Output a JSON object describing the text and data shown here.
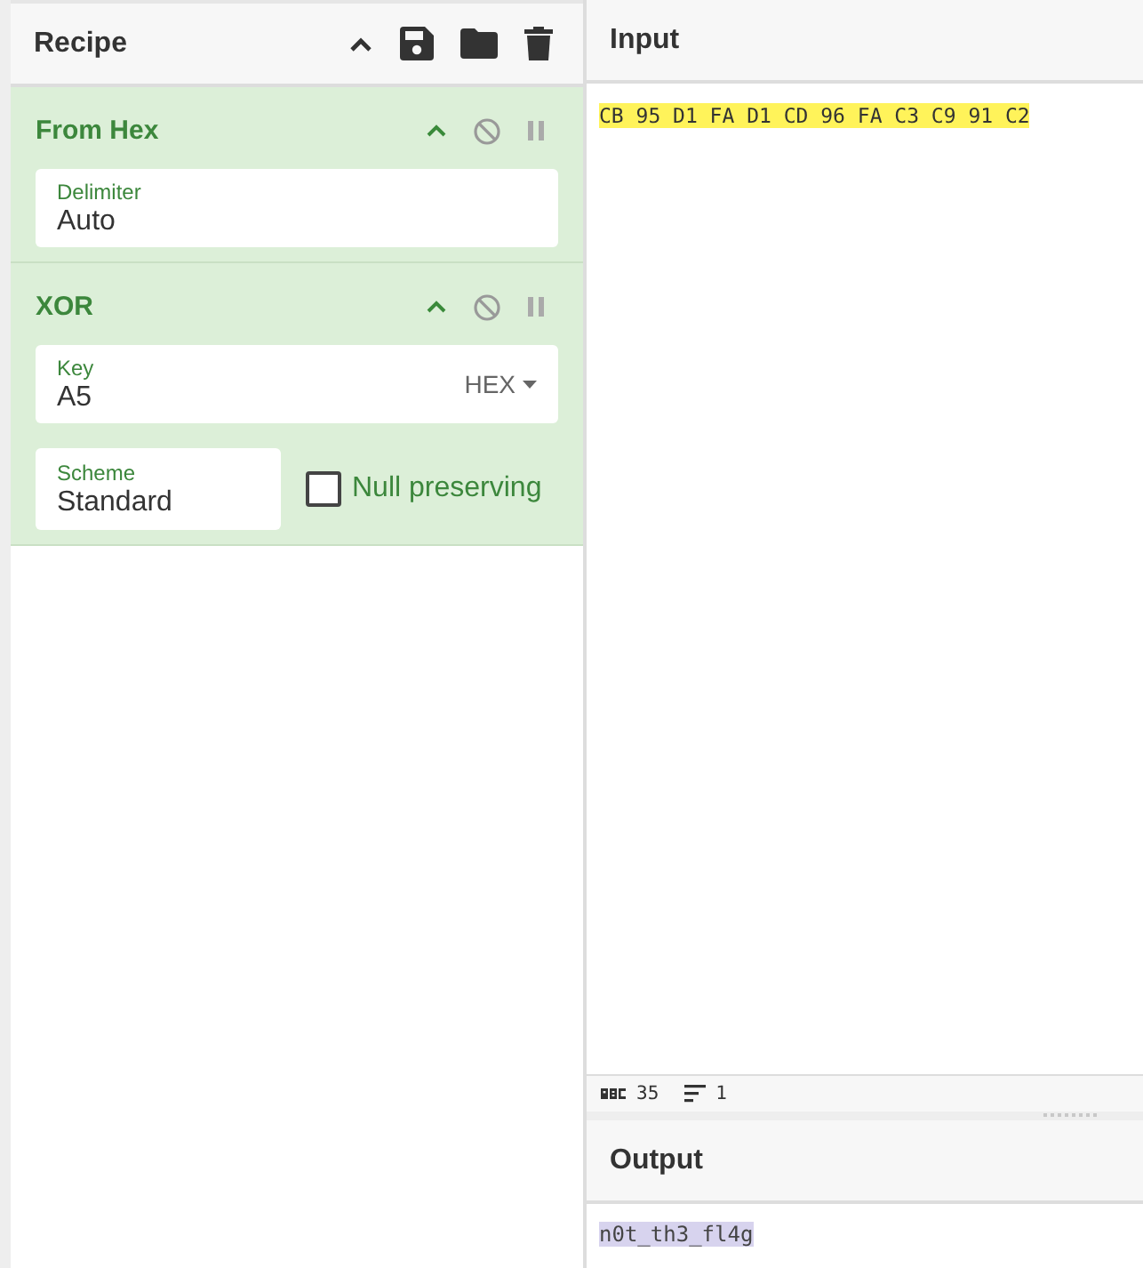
{
  "recipe": {
    "title": "Recipe",
    "operations": [
      {
        "name": "From Hex",
        "args": [
          {
            "kind": "text",
            "label": "Delimiter",
            "value": "Auto"
          }
        ]
      },
      {
        "name": "XOR",
        "args": [
          {
            "kind": "toggle",
            "label": "Key",
            "value": "A5",
            "option": "HEX"
          },
          {
            "kind": "text",
            "label": "Scheme",
            "value": "Standard"
          },
          {
            "kind": "checkbox",
            "label": "Null preserving",
            "checked": false
          }
        ]
      }
    ]
  },
  "input": {
    "title": "Input",
    "value": "CB 95 D1 FA D1 CD 96 FA C3 C9 91 C2"
  },
  "status_bar": {
    "length": "35",
    "lines": "1"
  },
  "output": {
    "title": "Output",
    "value": "n0t_th3_fl4g"
  }
}
